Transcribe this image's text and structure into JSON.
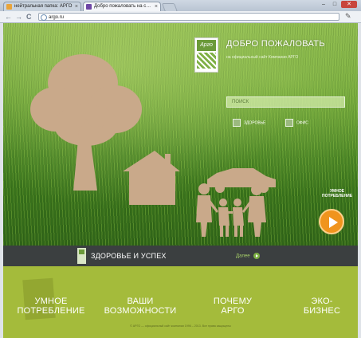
{
  "browser": {
    "tabs": [
      {
        "label": "нейтральная папка: АРГО",
        "active": false
      },
      {
        "label": "Добро пожаловать на с…",
        "active": true
      }
    ],
    "url": "argo.ru",
    "window_controls": {
      "minimize": "–",
      "maximize": "□",
      "close": "✕"
    },
    "nav": {
      "back": "←",
      "forward": "→",
      "reload": "C"
    }
  },
  "header": {
    "logo_text": "Арго",
    "welcome_title": "ДОБРО ПОЖАЛОВАТЬ",
    "welcome_subtitle": "на официальный сайт Компании АРГО"
  },
  "search": {
    "placeholder": "ПОИСК",
    "options": [
      "ЗДОРОВЬЕ",
      "ОФИС"
    ]
  },
  "promo": {
    "smart_label_line1": "УМНОЕ",
    "smart_label_line2": "ПОТРЕБЛЕНИЕ"
  },
  "section_bar": {
    "title": "ЗДОРОВЬЕ И УСПЕХ",
    "more_link": "Далее"
  },
  "menu": [
    {
      "line1": "УМНОЕ",
      "line2": "ПОТРЕБЛЕНИЕ"
    },
    {
      "line1": "ВАШИ",
      "line2": "ВОЗМОЖНОСТИ"
    },
    {
      "line1": "ПОЧЕМУ",
      "line2": "АРГО"
    },
    {
      "line1": "ЭКО-",
      "line2": "БИЗНЕС"
    }
  ],
  "footer": {
    "text": "© АРГО — официальный сайт компании 1996 – 2013. Все права защищены"
  },
  "colors": {
    "accent_orange": "#f0941d",
    "bottom_olive": "#a4bb3b",
    "dark_bar": "#3b3f40",
    "brand_green": "#6b9a3a"
  }
}
